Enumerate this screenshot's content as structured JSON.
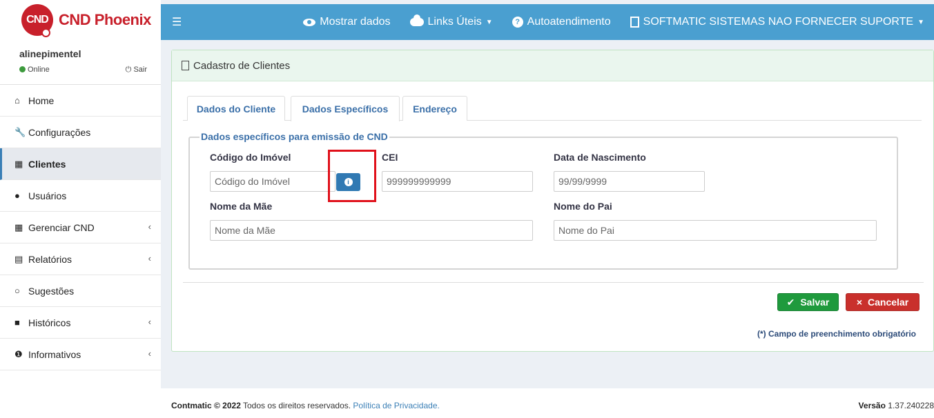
{
  "logo": {
    "badge": "CND",
    "name": "CND Phoenix"
  },
  "topbar": {
    "menu_icon": "hamburger-icon",
    "items": [
      {
        "icon": "eye-icon",
        "label": "Mostrar dados"
      },
      {
        "icon": "cloud-icon",
        "label": "Links Úteis"
      },
      {
        "icon": "question-icon",
        "label": "Autoatendimento"
      },
      {
        "icon": "building-icon",
        "label": "SOFTMATIC SISTEMAS NAO FORNECER SUPORTE"
      }
    ]
  },
  "user": {
    "name": "alinepimentel",
    "status": "Online",
    "logout": "Sair"
  },
  "sidebar": {
    "items": [
      {
        "icon": "home-icon",
        "label": "Home"
      },
      {
        "icon": "wrench-icon",
        "label": "Configurações"
      },
      {
        "icon": "building-icon",
        "label": "Clientes"
      },
      {
        "icon": "user-icon",
        "label": "Usuários"
      },
      {
        "icon": "calendar-icon",
        "label": "Gerenciar CND"
      },
      {
        "icon": "file-icon",
        "label": "Relatórios"
      },
      {
        "icon": "comments-icon",
        "label": "Sugestões"
      },
      {
        "icon": "archive-icon",
        "label": "Históricos"
      },
      {
        "icon": "info-icon",
        "label": "Informativos"
      }
    ]
  },
  "panel": {
    "title": "Cadastro de Clientes",
    "tabs": [
      "Dados do Cliente",
      "Dados Específicos",
      "Endereço"
    ],
    "legend": "Dados específicos para emissão de CND",
    "fields": {
      "codigo_imovel": {
        "label": "Código do Imóvel",
        "placeholder": "Código do Imóvel"
      },
      "cei": {
        "label": "CEI",
        "placeholder": "999999999999"
      },
      "data_nascimento": {
        "label": "Data de Nascimento",
        "placeholder": "99/99/9999"
      },
      "nome_mae": {
        "label": "Nome da Mãe",
        "placeholder": "Nome da Mãe"
      },
      "nome_pai": {
        "label": "Nome do Pai",
        "placeholder": "Nome do Pai"
      }
    },
    "buttons": {
      "save": "Salvar",
      "cancel": "Cancelar"
    },
    "required_note": "(*) Campo de preenchimento obrigatório"
  },
  "footer": {
    "brand": "Contmatic © 2022",
    "rights": "Todos os direitos reservados.",
    "privacy": "Política de Privacidade.",
    "version_label": "Versão",
    "version": "1.37.240228"
  },
  "colors": {
    "topbar": "#4a9fd0",
    "brand": "#c8202b",
    "save": "#1f9a3d",
    "cancel": "#c9302c",
    "highlight": "#e0101a"
  }
}
